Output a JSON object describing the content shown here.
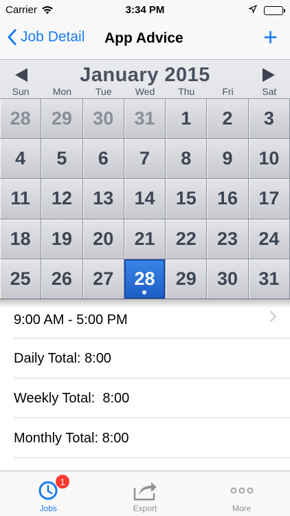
{
  "status_bar": {
    "carrier": "Carrier",
    "time": "3:34 PM",
    "icons": [
      "wifi-icon",
      "location-arrow-icon",
      "battery-icon"
    ]
  },
  "nav": {
    "back_label": "Job Detail",
    "title": "App Advice",
    "add_label": "+"
  },
  "calendar": {
    "month_year": "January 2015",
    "weekdays": [
      "Sun",
      "Mon",
      "Tue",
      "Wed",
      "Thu",
      "Fri",
      "Sat"
    ],
    "weeks": [
      [
        "28",
        "29",
        "30",
        "31",
        "1",
        "2",
        "3"
      ],
      [
        "4",
        "5",
        "6",
        "7",
        "8",
        "9",
        "10"
      ],
      [
        "11",
        "12",
        "13",
        "14",
        "15",
        "16",
        "17"
      ],
      [
        "18",
        "19",
        "20",
        "21",
        "22",
        "23",
        "24"
      ],
      [
        "25",
        "26",
        "27",
        "28",
        "29",
        "30",
        "31"
      ]
    ],
    "selected_day": "28",
    "selected_color": "#2a6fd6"
  },
  "list": {
    "shift": "9:00 AM - 5:00 PM",
    "daily_total": "Daily Total: 8:00",
    "weekly_total": "Weekly Total:  8:00",
    "monthly_total": "Monthly Total: 8:00"
  },
  "tabs": [
    {
      "label": "Jobs",
      "icon": "clock-icon",
      "badge": "1"
    },
    {
      "label": "Export",
      "icon": "share-icon"
    },
    {
      "label": "More",
      "icon": "more-dots-icon"
    }
  ],
  "colors": {
    "accent": "#1a7cf2",
    "badge": "#ff3b30"
  }
}
